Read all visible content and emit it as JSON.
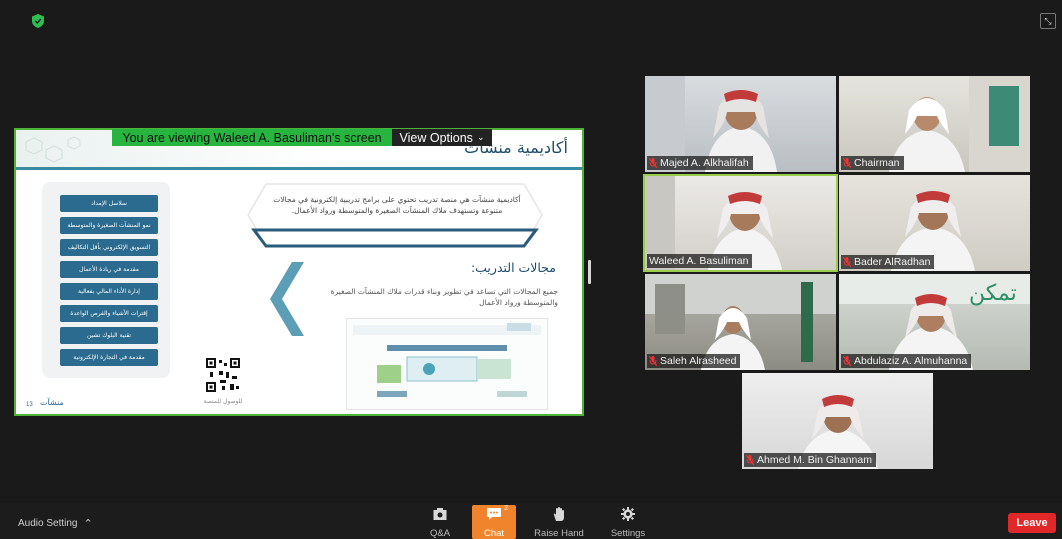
{
  "share": {
    "banner_text": "You are viewing Waleed A. Basuliman's screen",
    "view_options_label": "View Options"
  },
  "slide": {
    "title": "أكاديمية منشآت",
    "intro": "أكاديمية منشآت هي منصة تدريب تحتوي على برامج تدريبية إلكترونية في مجالات متنوعة وتستهدف ملاك المنشآت الصغيرة والمتوسطة ورواد الأعمال.",
    "training_title": "مجالات التدريب:",
    "training_desc": "جميع المجالات التي تساعد في تطوير وبناء قدرات ملاك المنشآت الصغيرة والمتوسطة ورواد الأعمال",
    "menu_items": [
      "سلاسل الإمداد",
      "نمو المنشآت الصغيرة والمتوسطة",
      "التسويق الإلكتروني بأقل التكاليف",
      "مقدمة في ريادة الأعمال",
      "إدارة الأداء المالي بفعالية",
      "إقترات الأشياء والفرص الواعدة",
      "تقنية البلوك تشين",
      "مقدمة في التجارة الإلكترونية"
    ],
    "qr_caption": "للوصول للمنصة",
    "page_number": "13",
    "brand_logo": "منشآت"
  },
  "participants": [
    {
      "name": "Majed A. Alkhalifah",
      "muted": true
    },
    {
      "name": "Chairman",
      "muted": true
    },
    {
      "name": "Waleed A. Basuliman",
      "muted": false
    },
    {
      "name": "Bader AlRadhan",
      "muted": true
    },
    {
      "name": "Saleh Alrasheed",
      "muted": true
    },
    {
      "name": "Abdulaziz A. Almuhanna",
      "muted": true
    },
    {
      "name": "Ahmed M. Bin Ghannam",
      "muted": true
    }
  ],
  "toolbar": {
    "audio_setting": "Audio Setting",
    "qa": "Q&A",
    "chat": "Chat",
    "chat_badge": "2",
    "raise_hand": "Raise Hand",
    "settings": "Settings",
    "leave": "Leave"
  },
  "colors": {
    "accent_green": "#27b53f",
    "chat_orange": "#f0842c",
    "leave_red": "#e02828",
    "slide_blue": "#2a6b8f"
  }
}
